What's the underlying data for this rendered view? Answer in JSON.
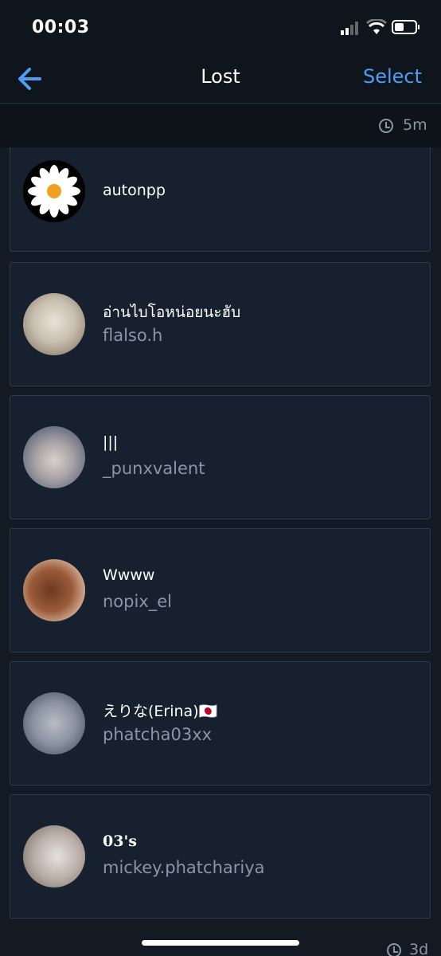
{
  "status_bar": {
    "time": "00:03"
  },
  "nav": {
    "title": "Lost",
    "action_label": "Select"
  },
  "top_time": {
    "label": "5m"
  },
  "users": [
    {
      "name": "autonpp",
      "handle": ""
    },
    {
      "name": "อ่านไบโอหน่อยนะฮับ",
      "handle": "flalso.h"
    },
    {
      "name": "|||",
      "handle": "_punxvalent"
    },
    {
      "name": "Wwww",
      "handle": "nopix_el"
    },
    {
      "name": "えりな(Erina)🇯🇵",
      "handle": "phatcha03xx"
    },
    {
      "name": "03's",
      "handle": "mickey.phatchariya"
    }
  ],
  "bottom_time": {
    "label": "3d"
  },
  "colors": {
    "accent": "#4d9ef0",
    "background": "#131a24",
    "card": "#17202e",
    "muted": "#8a96a6"
  }
}
